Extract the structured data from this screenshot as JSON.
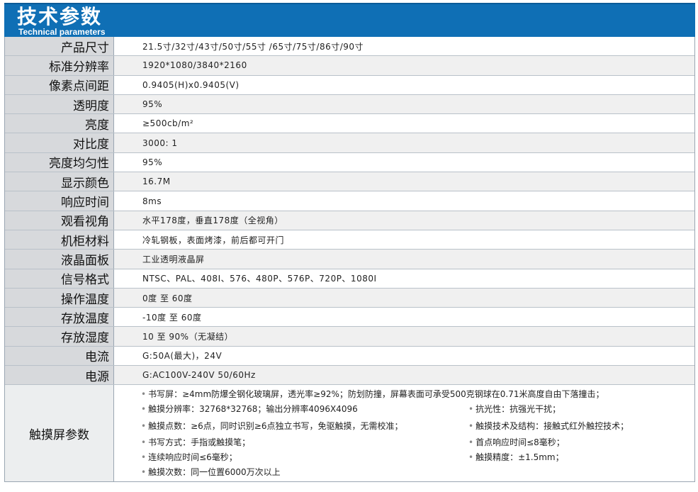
{
  "header": {
    "title_cn": "技术参数",
    "title_en": "Technical parameters"
  },
  "specs": [
    {
      "label": "产品尺寸",
      "value": "21.5寸/32寸/43寸/50寸/55寸 /65寸/75寸/86寸/90寸"
    },
    {
      "label": "标准分辨率",
      "value": "1920*1080/3840*2160"
    },
    {
      "label": "像素点间距",
      "value": "0.9405(H)x0.9405(V)"
    },
    {
      "label": "透明度",
      "value": "95%"
    },
    {
      "label": "亮度",
      "value": "≥500cb/m²"
    },
    {
      "label": "对比度",
      "value": "3000: 1"
    },
    {
      "label": "亮度均匀性",
      "value": "95%"
    },
    {
      "label": "显示颜色",
      "value": "16.7M"
    },
    {
      "label": "响应时间",
      "value": "8ms"
    },
    {
      "label": "观看视角",
      "value": "水平178度，垂直178度（全视角）"
    },
    {
      "label": "机柜材料",
      "value": "冷轧钢板，表面烤漆，前后都可开门"
    },
    {
      "label": "液晶面板",
      "value": "工业透明液晶屏"
    },
    {
      "label": "信号格式",
      "value": "NTSC、PAL、408I、576、480P、576P、720P、1080I"
    },
    {
      "label": "操作温度",
      "value": "0度 至 60度"
    },
    {
      "label": "存放温度",
      "value": "-10度 至 60度"
    },
    {
      "label": "存放湿度",
      "value": "10 至 90%（无凝结）"
    },
    {
      "label": "电流",
      "value": "G:50A(最大)，24V"
    },
    {
      "label": "电源",
      "value": "G:AC100V-240V 50/60Hz"
    }
  ],
  "touch": {
    "label": "触摸屏参数",
    "bullet": "•",
    "left": [
      "书写屏：≥4mm防爆全钢化玻璃屏，透光率≥92%；防划防撞，屏幕表面可承受500克钢球在0.71米高度自由下落撞击；",
      "触摸分辨率：32768*32768；输出分辨率4096X4096",
      "触摸点数：≥6点，同时识别≥6点独立书写，免驱触摸，无需校准；",
      "书写方式：手指或触摸笔；",
      "连续响应时间≤6毫秒；",
      "触摸次数：同一位置6000万次以上"
    ],
    "right": [
      "抗光性：抗强光干扰；",
      "触摸技术及结构：接触式红外触控技术；",
      "首点响应时间≤8毫秒；",
      "触摸精度：±1.5mm；"
    ]
  }
}
